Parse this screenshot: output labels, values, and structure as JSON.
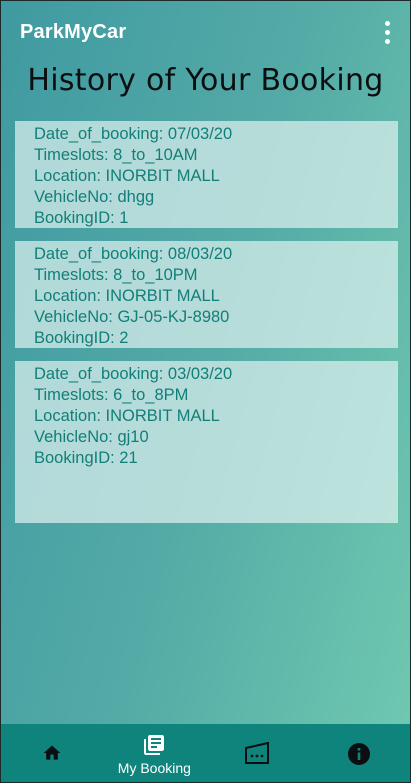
{
  "appbar": {
    "title": "ParkMyCar",
    "menu_icon": "more-vert-icon"
  },
  "page": {
    "title": "History of Your Booking"
  },
  "bookings": [
    {
      "date": "Date_of_booking: 07/03/20",
      "timeslot": "Timeslots: 8_to_10AM",
      "location": "Location: INORBIT MALL",
      "vehicle": "VehicleNo: dhgg",
      "booking_id": "BookingID: 1"
    },
    {
      "date": "Date_of_booking: 08/03/20",
      "timeslot": "Timeslots: 8_to_10PM",
      "location": "Location: INORBIT MALL",
      "vehicle": "VehicleNo: GJ-05-KJ-8980",
      "booking_id": "BookingID: 2"
    },
    {
      "date": "Date_of_booking: 03/03/20",
      "timeslot": "Timeslots: 6_to_8PM",
      "location": "Location: INORBIT MALL",
      "vehicle": "VehicleNo: gj10",
      "booking_id": "BookingID: 21"
    }
  ],
  "bottom_nav": {
    "items": [
      {
        "icon": "home-icon",
        "label": ""
      },
      {
        "icon": "booking-list-icon",
        "label": "My Booking",
        "active": true
      },
      {
        "icon": "parking-icon",
        "label": ""
      },
      {
        "icon": "info-icon",
        "label": ""
      }
    ]
  },
  "colors": {
    "nav_background": "#0f847c",
    "card_text": "#117f78",
    "title_text": "#0b0f12"
  }
}
